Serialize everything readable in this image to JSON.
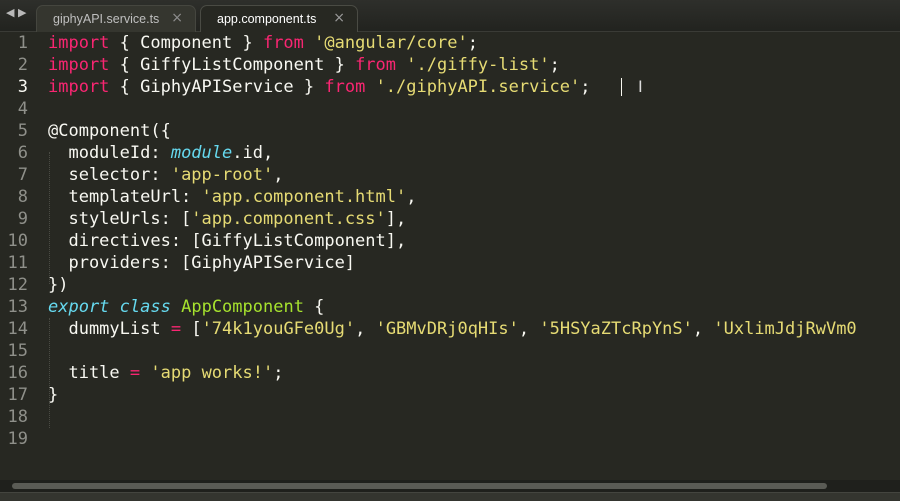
{
  "tabs": [
    {
      "label": "giphyAPI.service.ts",
      "active": false
    },
    {
      "label": "app.component.ts",
      "active": true
    }
  ],
  "nav": {
    "back_glyph": "◀",
    "forward_glyph": "▶"
  },
  "close_glyph": "×",
  "colors": {
    "background": "#272822",
    "keyword": "#f92672",
    "string": "#e6db74",
    "type": "#66d9ef",
    "class_name": "#a6e22e",
    "plain": "#f8f8f2",
    "line_number": "#8f908a"
  },
  "line_numbers": [
    "1",
    "2",
    "3",
    "4",
    "5",
    "6",
    "7",
    "8",
    "9",
    "10",
    "11",
    "12",
    "13",
    "14",
    "15",
    "16",
    "17",
    "18",
    "19"
  ],
  "code": {
    "l1": {
      "kw": "import",
      "a": " { Component } ",
      "from": "from",
      "sp": " ",
      "str": "'@angular/core'",
      "end": ";"
    },
    "l2": {
      "kw": "import",
      "a": " { GiffyListComponent } ",
      "from": "from",
      "sp": " ",
      "str": "'./giffy-list'",
      "end": ";"
    },
    "l3": {
      "kw": "import",
      "a": " { GiphyAPIService } ",
      "from": "from",
      "sp": " ",
      "str": "'./giphyAPI.service'",
      "end": ";"
    },
    "l5": {
      "text": "@Component({"
    },
    "l6": {
      "key": "  moduleId: ",
      "type": "module",
      "rest": ".id,"
    },
    "l7": {
      "key": "  selector: ",
      "str": "'app-root'",
      "end": ","
    },
    "l8": {
      "key": "  templateUrl: ",
      "str": "'app.component.html'",
      "end": ","
    },
    "l9": {
      "key": "  styleUrls: [",
      "str": "'app.component.css'",
      "end": "],"
    },
    "l10": {
      "text": "  directives: [GiffyListComponent],"
    },
    "l11": {
      "text": "  providers: [GiphyAPIService]"
    },
    "l12": {
      "text": "})"
    },
    "l13": {
      "export": "export",
      "sp1": " ",
      "class": "class",
      "sp2": " ",
      "name": "AppComponent",
      "end": " {"
    },
    "l14": {
      "key": "  dummyList ",
      "op": "=",
      "open": " [",
      "s1": "'74k1youGFe0Ug'",
      "c1": ", ",
      "s2": "'GBMvDRj0qHIs'",
      "c2": ", ",
      "s3": "'5HSYaZTcRpYnS'",
      "c3": ", ",
      "s4": "'UxlimJdjRwVm0"
    },
    "l16": {
      "key": "  title ",
      "op": "=",
      "sp": " ",
      "str": "'app works!'",
      "end": ";"
    },
    "l17": {
      "text": "}"
    }
  },
  "ibeam_glyph": "I"
}
